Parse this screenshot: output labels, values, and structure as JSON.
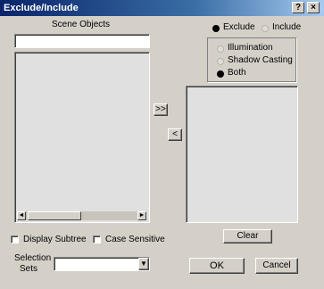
{
  "window": {
    "title": "Exclude/Include",
    "help_glyph": "?",
    "close_glyph": "×"
  },
  "scene_objects": {
    "label": "Scene Objects",
    "filter_value": ""
  },
  "scrollbar": {
    "left_arrow": "◄",
    "right_arrow": "►"
  },
  "transfer": {
    "add_label": ">>",
    "remove_label": "<"
  },
  "mode": {
    "exclude_label": "Exclude",
    "include_label": "Include",
    "selected": "Exclude"
  },
  "affect": {
    "options": [
      "Illumination",
      "Shadow Casting",
      "Both"
    ],
    "selected": "Both"
  },
  "options": {
    "display_subtree_label": "Display Subtree",
    "case_sensitive_label": "Case Sensitive"
  },
  "selection_sets": {
    "label_line1": "Selection",
    "label_line2": "Sets",
    "value": "",
    "dropdown_glyph": "▼"
  },
  "buttons": {
    "clear": "Clear",
    "ok": "OK",
    "cancel": "Cancel"
  }
}
